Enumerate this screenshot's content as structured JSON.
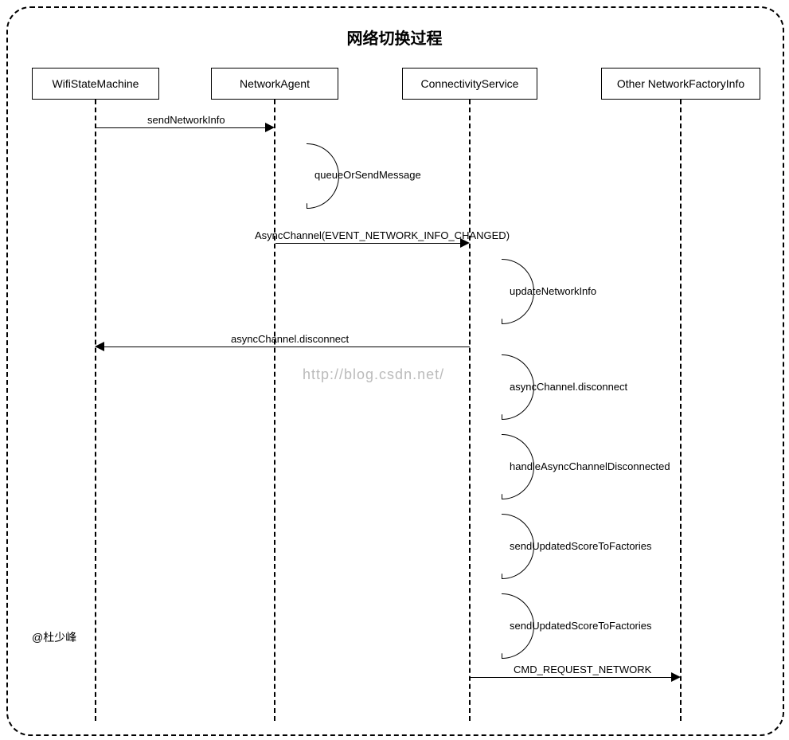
{
  "title": "网络切换过程",
  "actors": {
    "a1": "WifiStateMachine",
    "a2": "NetworkAgent",
    "a3": "ConnectivityService",
    "a4": "Other NetworkFactoryInfo"
  },
  "messages": {
    "m1": "sendNetworkInfo",
    "m2": "queueOrSendMessage",
    "m3": "AsyncChannel(EVENT_NETWORK_INFO_CHANGED)",
    "m4": "updateNetworkInfo",
    "m5": "asyncChannel.disconnect",
    "m6": "asyncChannel.disconnect",
    "m7": "handleAsyncChannelDisconnected",
    "m8": "sendUpdatedScoreToFactories",
    "m9": "sendUpdatedScoreToFactories",
    "m10": "CMD_REQUEST_NETWORK"
  },
  "watermark": "http://blog.csdn.net/",
  "author": "@杜少峰"
}
